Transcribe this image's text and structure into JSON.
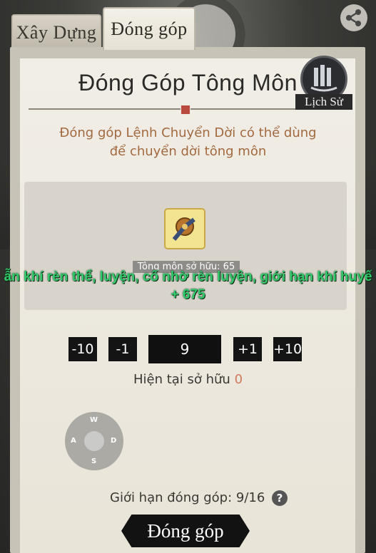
{
  "tabs": [
    {
      "label": "Xây Dựng",
      "active": false
    },
    {
      "label": "Đóng góp",
      "active": true
    }
  ],
  "header": {
    "title": "Đóng Góp Tông Môn",
    "history_label": "Lịch Sử"
  },
  "description": {
    "line1": "Đóng góp Lệnh Chuyển Dời có thể dùng",
    "line2": "để chuyển dời tông môn"
  },
  "item": {
    "owned_label": "Tông môn sở hữu: 65"
  },
  "toast": {
    "line1": "ẫn khí rèn thể, luyện, cố nhờ rèn luyện, giới hạn khí huyế",
    "line2": "+ 675"
  },
  "stepper": {
    "minus10": "-10",
    "minus1": "-1",
    "value": "9",
    "plus1": "+1",
    "plus10": "+10"
  },
  "owned": {
    "label": "Hiện tại sở hữu",
    "count": "0"
  },
  "joystick": {
    "up": "W",
    "left": "A",
    "right": "D",
    "down": "S"
  },
  "limit": {
    "text": "Giới hạn đóng góp: 9/16",
    "help": "?"
  },
  "action": {
    "contribute_label": "Đóng góp"
  },
  "colors": {
    "description": "#a2693f",
    "owned_count": "#d27a5d",
    "toast": "#32c96b"
  },
  "icons": [
    "share-icon",
    "history-icon",
    "seal-icon",
    "item-icon",
    "help-icon"
  ]
}
